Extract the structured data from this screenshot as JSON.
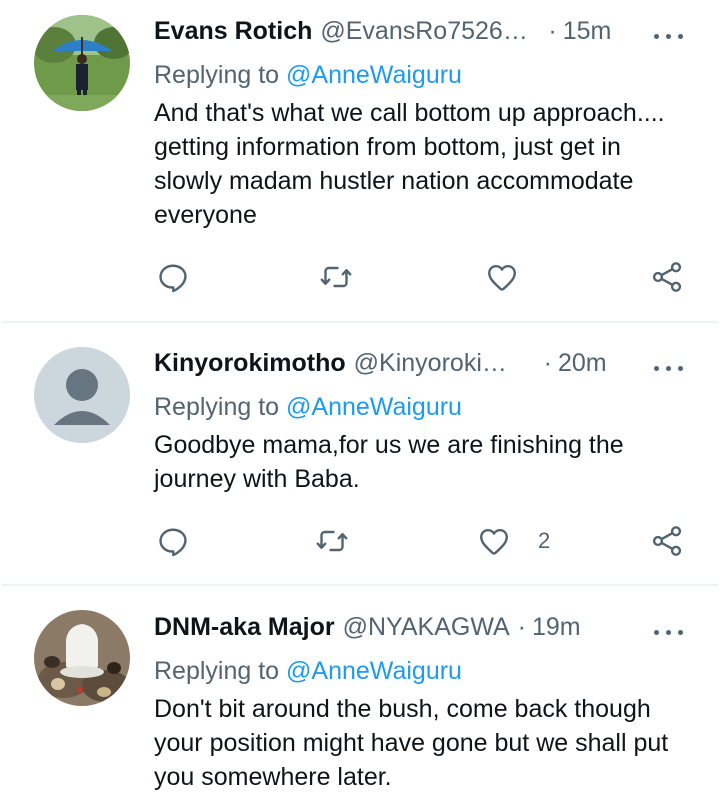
{
  "tweets": [
    {
      "name": "Evans Rotich",
      "handle": "@EvansRo752637...",
      "separator": "·",
      "time": "15m",
      "replying_label": "Replying to",
      "replying_to": "@AnneWaiguru",
      "text": "And that's what we call bottom up approach.... getting information from bottom, just get in slowly madam hustler nation accommodate everyone",
      "likes": ""
    },
    {
      "name": "Kinyorokimotho",
      "handle": "@Kinyorokim...",
      "separator": "·",
      "time": "20m",
      "replying_label": "Replying to",
      "replying_to": "@AnneWaiguru",
      "text": "Goodbye mama,for us we are finishing the journey with Baba.",
      "likes": "2"
    },
    {
      "name": "DNM-aka Major",
      "handle": "@NYAKAGWA",
      "separator": "·",
      "time": "19m",
      "replying_label": "Replying to",
      "replying_to": "@AnneWaiguru",
      "text": "Don't bit around the bush, come back though your position might have gone but we shall put you somewhere later.",
      "likes": ""
    }
  ],
  "colors": {
    "text": "#0f1419",
    "secondary": "#536471",
    "link": "#1d9bf0",
    "divider": "#eff3f4"
  },
  "icons": [
    "more-icon",
    "reply-icon",
    "retweet-icon",
    "like-icon",
    "share-icon"
  ]
}
